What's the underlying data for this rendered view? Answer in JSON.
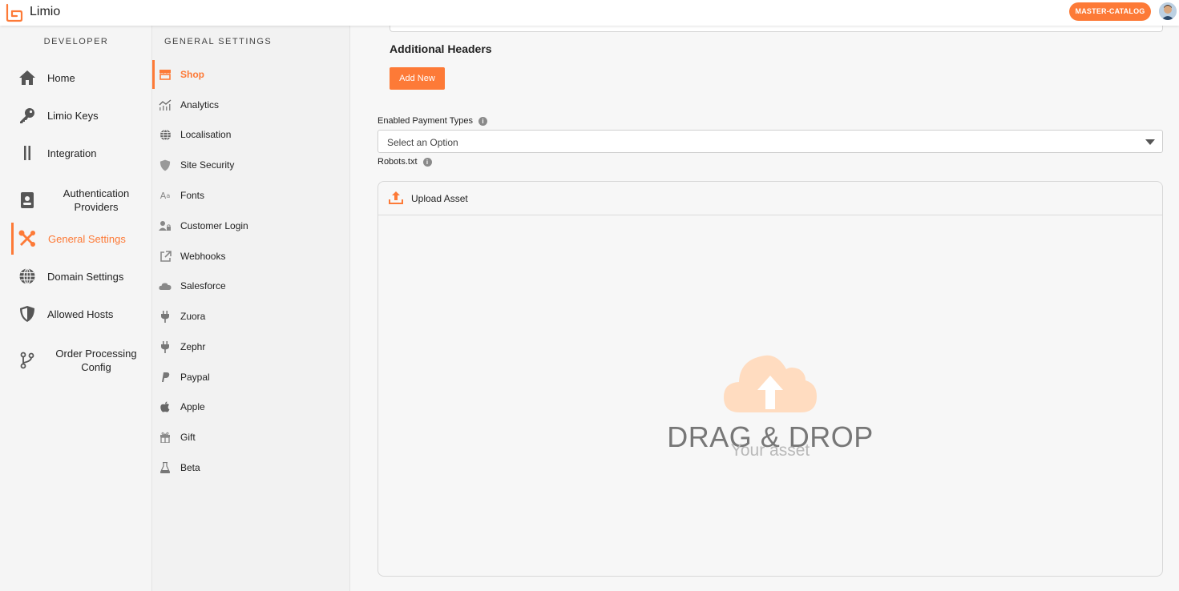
{
  "header": {
    "app_name": "Limio",
    "catalog_badge": "MASTER-CATALOG",
    "brand_color": "#fd7a37"
  },
  "sidebar": {
    "title": "DEVELOPER",
    "items": [
      {
        "label": "Home",
        "icon": "home-icon"
      },
      {
        "label": "Limio Keys",
        "icon": "key-icon"
      },
      {
        "label": "Integration",
        "icon": "integration-icon"
      },
      {
        "label": "Authentication Providers",
        "icon": "id-badge-icon"
      },
      {
        "label": "General Settings",
        "icon": "tools-icon",
        "active": true
      },
      {
        "label": "Domain Settings",
        "icon": "globe-icon"
      },
      {
        "label": "Allowed Hosts",
        "icon": "shield-icon"
      },
      {
        "label": "Order Processing Config",
        "icon": "branch-icon"
      }
    ]
  },
  "subnav": {
    "title": "GENERAL SETTINGS",
    "items": [
      {
        "label": "Shop",
        "icon": "shop-icon",
        "active": true
      },
      {
        "label": "Analytics",
        "icon": "chart-icon"
      },
      {
        "label": "Localisation",
        "icon": "globe-icon"
      },
      {
        "label": "Site Security",
        "icon": "shield-icon"
      },
      {
        "label": "Fonts",
        "icon": "font-icon"
      },
      {
        "label": "Customer Login",
        "icon": "user-lock-icon"
      },
      {
        "label": "Webhooks",
        "icon": "external-link-icon"
      },
      {
        "label": "Salesforce",
        "icon": "cloud-icon"
      },
      {
        "label": "Zuora",
        "icon": "plug-icon"
      },
      {
        "label": "Zephr",
        "icon": "plug-icon"
      },
      {
        "label": "Paypal",
        "icon": "paypal-icon"
      },
      {
        "label": "Apple",
        "icon": "apple-icon"
      },
      {
        "label": "Gift",
        "icon": "gift-icon"
      },
      {
        "label": "Beta",
        "icon": "flask-icon"
      }
    ]
  },
  "main": {
    "section_heading": "Additional Headers",
    "add_new_label": "Add New",
    "payment_types_label": "Enabled Payment Types",
    "payment_types_value": "Select an Option",
    "robots_label": "Robots.txt",
    "upload_label": "Upload Asset",
    "drag_drop_title": "DRAG & DROP",
    "drag_drop_sub": "Your asset"
  }
}
